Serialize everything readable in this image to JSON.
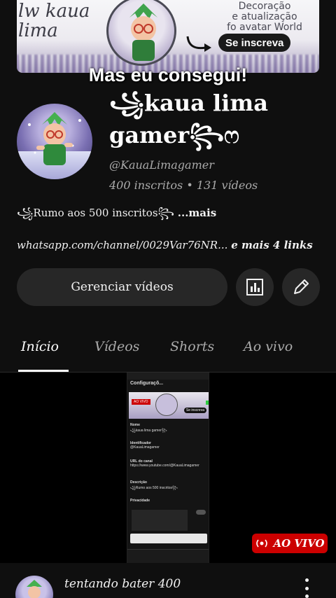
{
  "banner": {
    "script_text": "lw kaua\nlima",
    "side_text": "Decoração\ne atualização\nfo avatar World",
    "subscribe_label": "Se inscreva"
  },
  "overlay": {
    "text": "Mas eu consegui!"
  },
  "channel": {
    "name": "꧁kaua lima gamer꧂ෆ",
    "handle": "@KauaLimagamer",
    "stats": "400 inscritos • 131 vídeos",
    "description": "꧁Rumo aos 500 inscritos꧂",
    "description_more": "...mais",
    "links": "whatsapp.com/channel/0029Var76NR...",
    "links_more": "e mais 4 links"
  },
  "actions": {
    "manage_label": "Gerenciar vídeos",
    "analytics_icon": "analytics-icon",
    "edit_icon": "pencil-icon"
  },
  "tabs": [
    {
      "label": "Início",
      "active": true
    },
    {
      "label": "Vídeos",
      "active": false
    },
    {
      "label": "Shorts",
      "active": false
    },
    {
      "label": "Ao vivo",
      "active": false
    }
  ],
  "live": {
    "label": "AO VIVO",
    "color": "#cc0000"
  },
  "video": {
    "title": "tentando bater 400"
  },
  "phone_screen": {
    "header": "Configuraçõ...",
    "banner_live": "AO VIVO",
    "banner_subscribe": "Se inscreva",
    "rows": [
      {
        "label": "Nome",
        "value": "꧁kaua lima gamer꧂"
      },
      {
        "label": "Identificador",
        "value": "@KauaLimagamer"
      },
      {
        "label": "URL do canal",
        "value": "https://www.youtube.com/@KauaLimagamer"
      },
      {
        "label": "Descrição",
        "value": "꧁Rumo aos 500 inscritos꧂"
      },
      {
        "label": "Privacidade",
        "value": ""
      }
    ]
  }
}
